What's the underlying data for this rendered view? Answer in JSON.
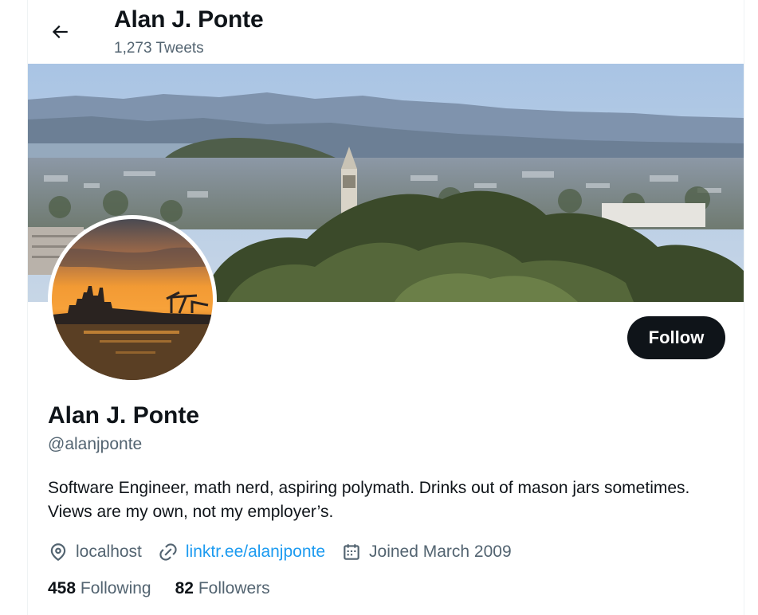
{
  "header": {
    "title": "Alan J. Ponte",
    "tweet_count": "1,273 Tweets"
  },
  "profile": {
    "name": "Alan J. Ponte",
    "handle": "@alanjponte",
    "bio": "Software Engineer, math nerd, aspiring polymath. Drinks out of mason jars sometimes. Views are my own, not my employer’s.",
    "follow_label": "Follow",
    "location": "localhost",
    "website": "linktr.ee/alanjponte",
    "joined": "Joined March 2009",
    "following_count": "458",
    "following_label": "Following",
    "followers_count": "82",
    "followers_label": "Followers"
  },
  "colors": {
    "text_primary": "#0f1419",
    "text_secondary": "#536471",
    "link": "#1d9bf0",
    "button_bg": "#0f1419"
  },
  "icons": {
    "back": "arrow-left-icon",
    "location": "location-pin-icon",
    "website": "link-icon",
    "joined": "calendar-icon"
  }
}
